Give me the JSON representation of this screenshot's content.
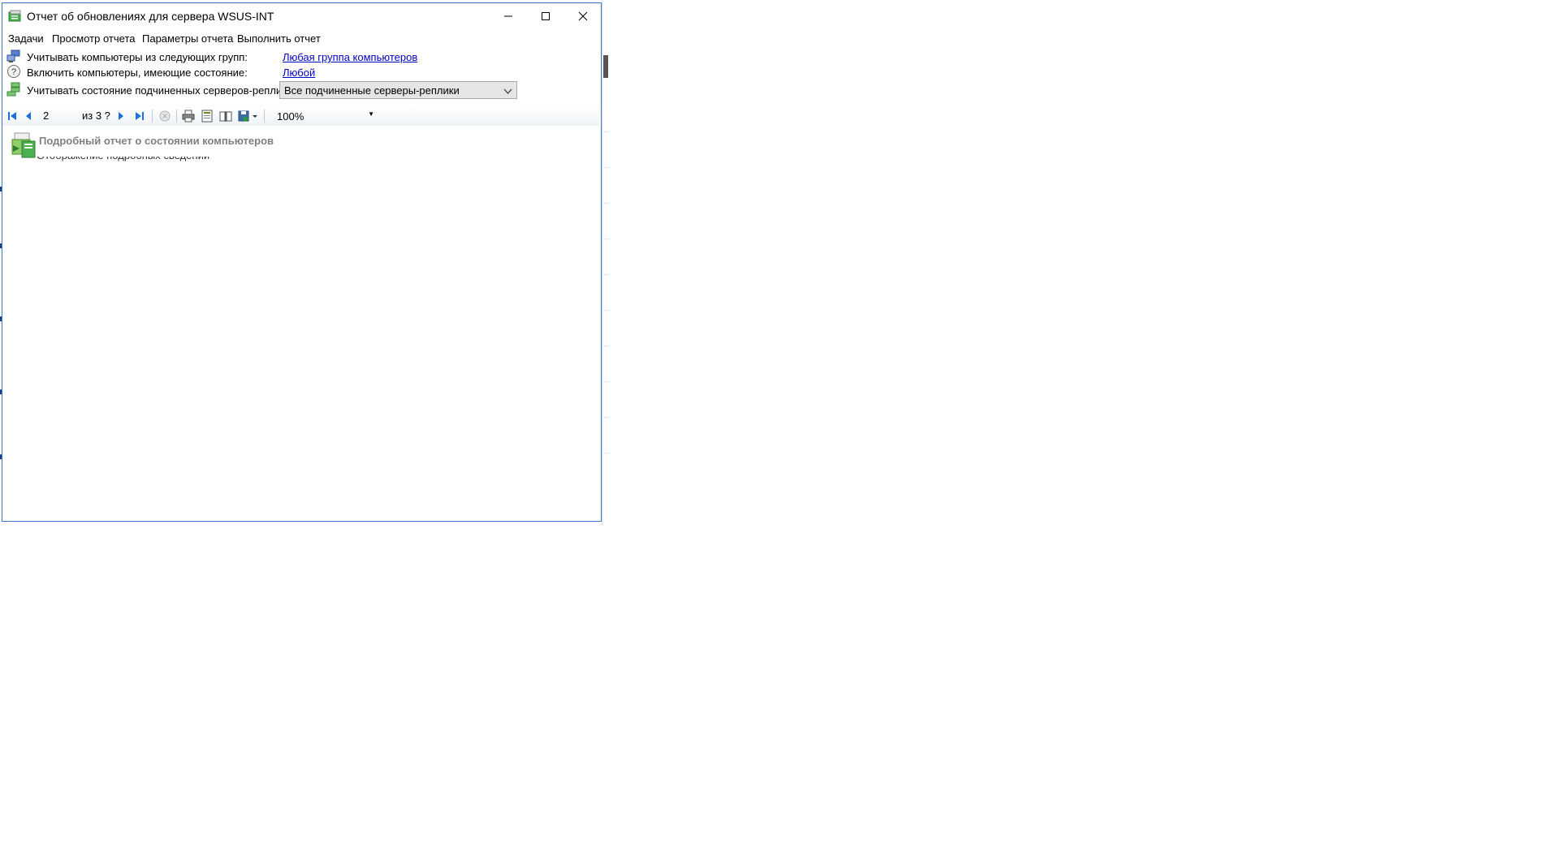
{
  "window": {
    "title": "Отчет об обновлениях для сервера WSUS-INT",
    "icon": "report-window-icon",
    "controls": {
      "minimize": "minimize-icon",
      "maximize": "maximize-icon",
      "close": "close-icon"
    }
  },
  "menu": {
    "items": [
      "Задачи",
      "Просмотр отчета",
      "Параметры отчета",
      "Выполнить отчет"
    ]
  },
  "parameters": {
    "groups_label": "Учитывать компьютеры из следующих групп:",
    "groups_value": "Любая группа компьютеров",
    "status_label": "Включить компьютеры, имеющие состояние:",
    "status_value": "Любой",
    "replica_label": "Учитывать состояние подчиненных серверов-реплик:",
    "replica_value": "Все подчиненные серверы-реплики"
  },
  "toolbar": {
    "page_current": "2",
    "page_of": "из 3 ?",
    "zoom": "100%"
  },
  "report": {
    "title": "Подробный отчет о состоянии компьютеров"
  },
  "colors": {
    "window_border": "#3a7bd5",
    "link": "#0000cc",
    "report_title": "#808080",
    "nav_arrow": "#1e6fd9"
  }
}
